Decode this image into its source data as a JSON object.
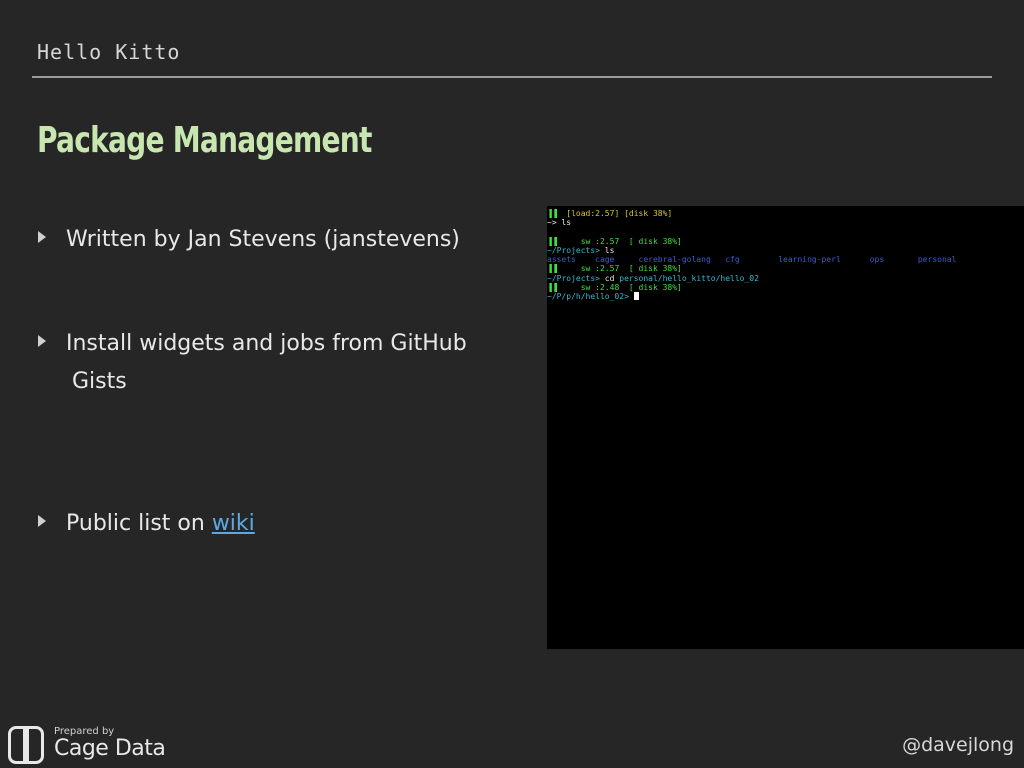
{
  "header": {
    "title": "Hello Kitto"
  },
  "slide": {
    "title": "Package Management"
  },
  "bullets": [
    {
      "text": "Written by Jan Stevens (janstevens)"
    },
    {
      "text": "Install widgets and jobs from GitHub",
      "continuation": "Gists"
    },
    {
      "text": "Public list on ",
      "link": "wiki"
    }
  ],
  "terminal": {
    "lines": [
      {
        "seg": [
          {
            "t": "▌▌",
            "c": "gb"
          },
          {
            "t": "  [load:2.57] [disk 38%]",
            "c": "y"
          }
        ]
      },
      {
        "seg": [
          {
            "t": "~> ls",
            "c": "w"
          }
        ]
      },
      {
        "seg": []
      },
      {
        "seg": [
          {
            "t": "▌▌",
            "c": "gb"
          },
          {
            "t": "     sw :2.57  [ disk 38%]",
            "c": "g"
          }
        ]
      },
      {
        "seg": [
          {
            "t": "~/Projects> ",
            "c": "c"
          },
          {
            "t": "ls",
            "c": "w"
          }
        ]
      },
      {
        "seg": [
          {
            "t": "assets    cage     cerebral-golang   cfg        learning-perl      ops       personal",
            "c": "b"
          }
        ]
      },
      {
        "seg": [
          {
            "t": "▌▌",
            "c": "gb"
          },
          {
            "t": "     sw :2.57  [ disk 38%]",
            "c": "g"
          }
        ]
      },
      {
        "seg": [
          {
            "t": "~/Projects> ",
            "c": "c"
          },
          {
            "t": "cd ",
            "c": "w"
          },
          {
            "t": "personal/hello_kitto/hello_02",
            "c": "c"
          }
        ]
      },
      {
        "seg": [
          {
            "t": "▌▌",
            "c": "gb"
          },
          {
            "t": "     sw :2.48  [ disk 38%]",
            "c": "g"
          }
        ]
      },
      {
        "seg": [
          {
            "t": "~/P/p/h/hello_02> ",
            "c": "c"
          },
          {
            "cursor": true
          }
        ]
      }
    ]
  },
  "footer": {
    "prepared_by": "Prepared by",
    "brand": "Cage Data",
    "handle": "@davejlong"
  },
  "colors": {
    "background": "#262626",
    "title": "#c8e6b0",
    "link": "#5aa9e6",
    "terminal_bg": "#000000",
    "terminal_green": "#3ee03e",
    "terminal_yellow": "#d8c830",
    "terminal_blue": "#3a5bd8",
    "terminal_cyan": "#38b8d0"
  }
}
